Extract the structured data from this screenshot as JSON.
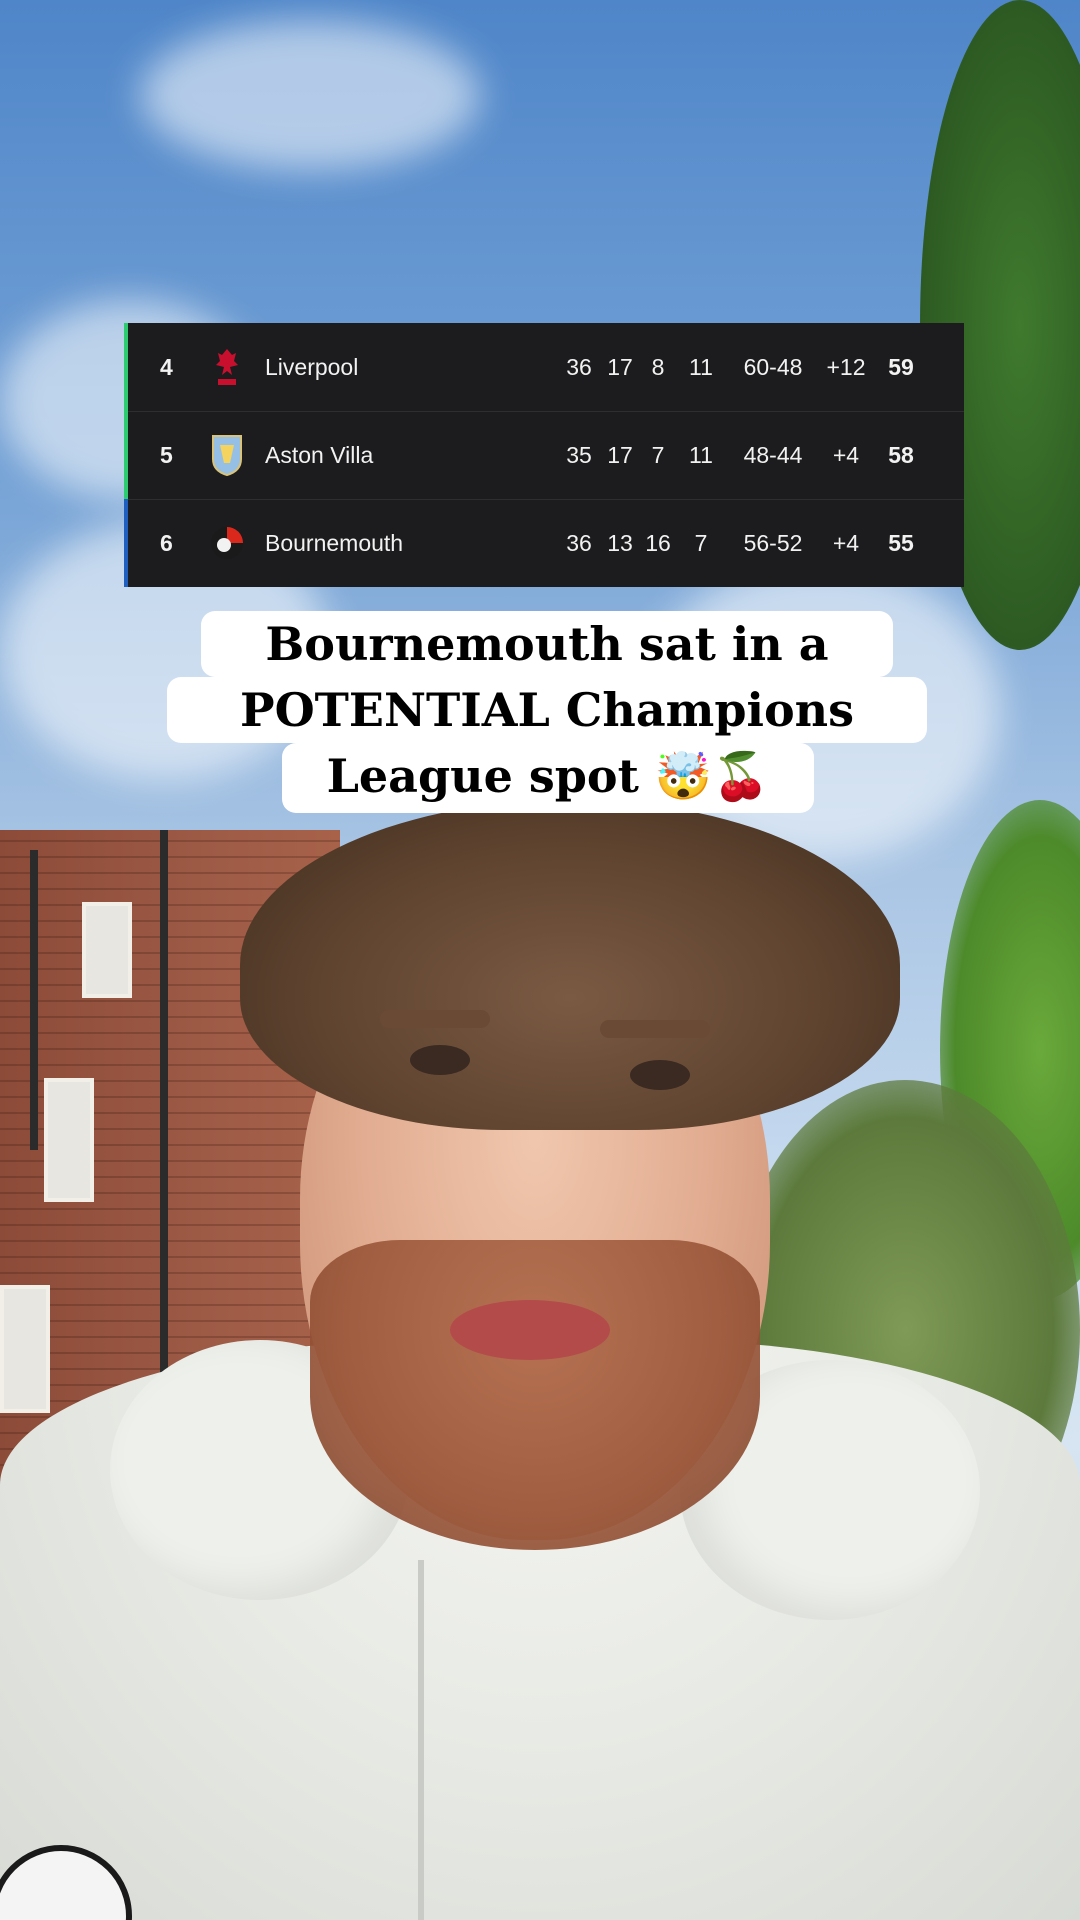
{
  "table": {
    "rows": [
      {
        "pos": "4",
        "team": "Liverpool",
        "crest": "liverpool-crest-icon",
        "p": "36",
        "w": "17",
        "d": "8",
        "l": "11",
        "goals": "60-48",
        "gd": "+12",
        "pts": "59",
        "bar_color": "#2ecc71",
        "crest_color": "#c8102e"
      },
      {
        "pos": "5",
        "team": "Aston Villa",
        "crest": "aston-villa-crest-icon",
        "p": "35",
        "w": "17",
        "d": "7",
        "l": "11",
        "goals": "48-44",
        "gd": "+4",
        "pts": "58",
        "bar_color": "#2ecc71",
        "crest_color": "#95bfe5"
      },
      {
        "pos": "6",
        "team": "Bournemouth",
        "crest": "bournemouth-crest-icon",
        "p": "36",
        "w": "13",
        "d": "16",
        "l": "7",
        "goals": "56-52",
        "gd": "+4",
        "pts": "55",
        "bar_color": "#1f5fbf",
        "crest_color": "#da291c"
      }
    ]
  },
  "caption": {
    "line1": "Bournemouth sat in a",
    "line2": "POTENTIAL Champions",
    "line3": "League spot 🤯🍒"
  }
}
